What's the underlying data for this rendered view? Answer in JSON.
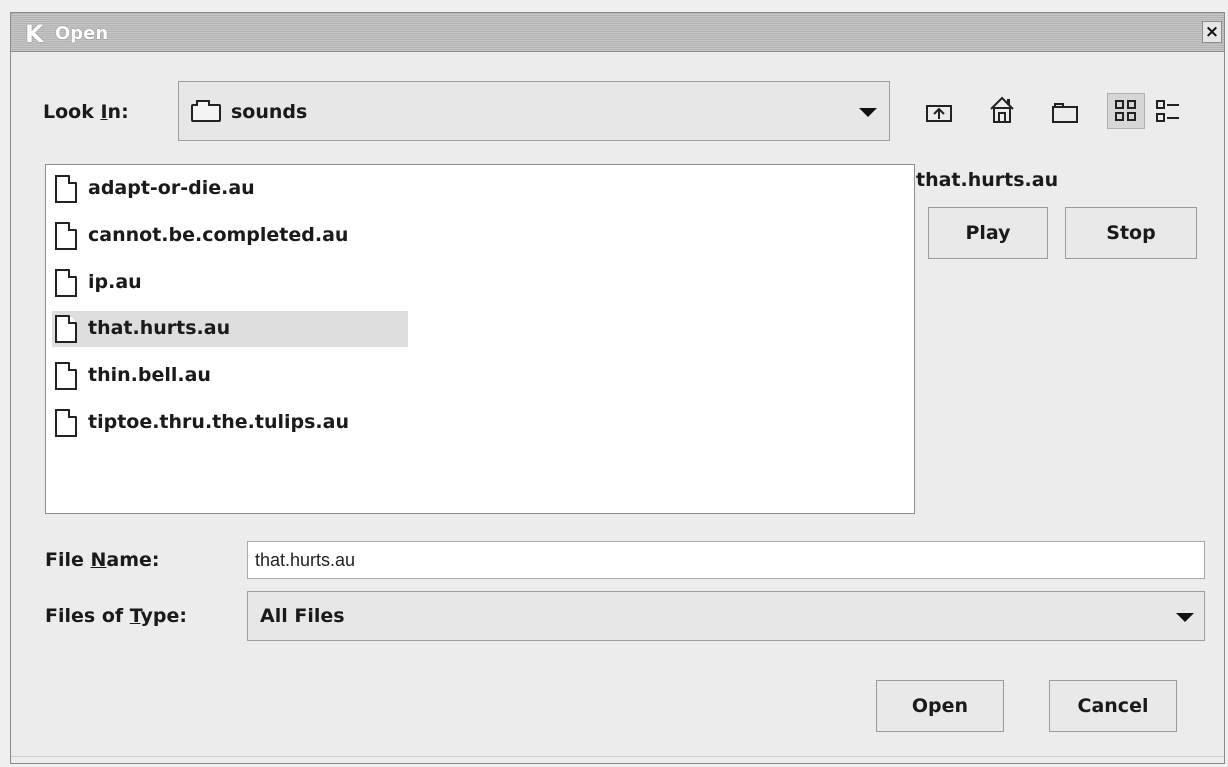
{
  "window": {
    "title": "Open",
    "app_icon": "K",
    "close_glyph": "×"
  },
  "look_in": {
    "label_before": "Look ",
    "label_mnemonic": "I",
    "label_after": "n:",
    "folder_icon": "folder-icon",
    "value": "sounds"
  },
  "toolbar": {
    "buttons": [
      {
        "name": "up-one-level-icon"
      },
      {
        "name": "home-icon"
      },
      {
        "name": "new-folder-icon"
      },
      {
        "name": "list-view-icon",
        "selected": true
      },
      {
        "name": "details-view-icon"
      }
    ]
  },
  "files": [
    {
      "name": "adapt-or-die.au"
    },
    {
      "name": "cannot.be.completed.au"
    },
    {
      "name": "ip.au"
    },
    {
      "name": "that.hurts.au",
      "selected": true
    },
    {
      "name": "thin.bell.au"
    },
    {
      "name": "tiptoe.thru.the.tulips.au"
    }
  ],
  "preview": {
    "file_name": "that.hurts.au",
    "play_label": "Play",
    "stop_label": "Stop"
  },
  "file_name_field": {
    "label_before": "File ",
    "label_mnemonic": "N",
    "label_after": "ame:",
    "value": "that.hurts.au"
  },
  "file_type": {
    "label_before": "Files of ",
    "label_mnemonic": "T",
    "label_after": "ype:",
    "value": "All Files"
  },
  "actions": {
    "open_label": "Open",
    "cancel_label": "Cancel"
  }
}
